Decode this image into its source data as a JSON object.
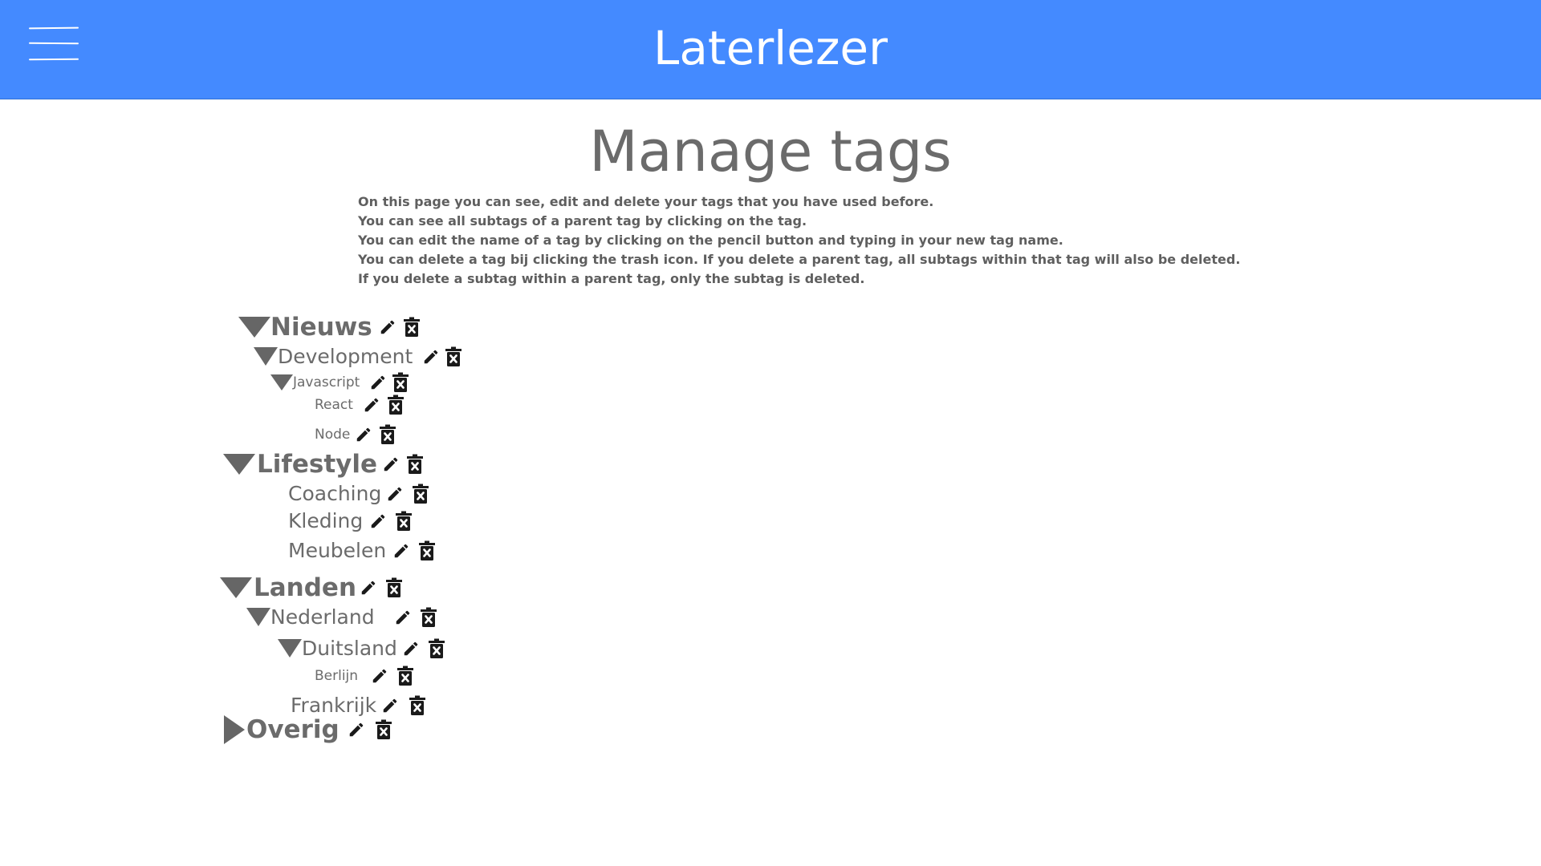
{
  "header": {
    "title": "Laterlezer",
    "menu_icon": "hamburger-icon",
    "background": "#448aff"
  },
  "page": {
    "title": "Manage tags",
    "intro": [
      "On this page you can see, edit and delete your tags that you have used before.",
      "You can see all subtags of a parent tag by clicking on the tag.",
      "You can edit the name of a tag by clicking on the pencil button and typing in your new tag name.",
      "You can delete a tag bij clicking the trash icon. If you delete a parent tag, all subtags within that tag will also be deleted.",
      "If you delete a subtag within a parent tag, only the subtag is deleted."
    ]
  },
  "icons": {
    "edit": "pencil-icon",
    "delete": "trash-icon",
    "expanded": "triangle-down-icon",
    "collapsed": "triangle-right-icon"
  },
  "tags": [
    {
      "name": "Nieuws",
      "level": 1,
      "expanded": true
    },
    {
      "name": "Development",
      "level": 2,
      "expanded": true
    },
    {
      "name": "Javascript",
      "level": 3,
      "expanded": true
    },
    {
      "name": "React",
      "level": 4
    },
    {
      "name": "Node",
      "level": 4
    },
    {
      "name": "Lifestyle",
      "level": 1,
      "expanded": true
    },
    {
      "name": "Coaching",
      "level": 2
    },
    {
      "name": "Kleding",
      "level": 2
    },
    {
      "name": "Meubelen",
      "level": 2
    },
    {
      "name": "Landen",
      "level": 1,
      "expanded": true
    },
    {
      "name": "Nederland",
      "level": 2,
      "expanded": true
    },
    {
      "name": "Duitsland",
      "level": 3,
      "expanded": true
    },
    {
      "name": "Berlijn",
      "level": 4
    },
    {
      "name": "Frankrijk",
      "level": 2
    },
    {
      "name": "Overig",
      "level": 1,
      "expanded": false
    }
  ]
}
